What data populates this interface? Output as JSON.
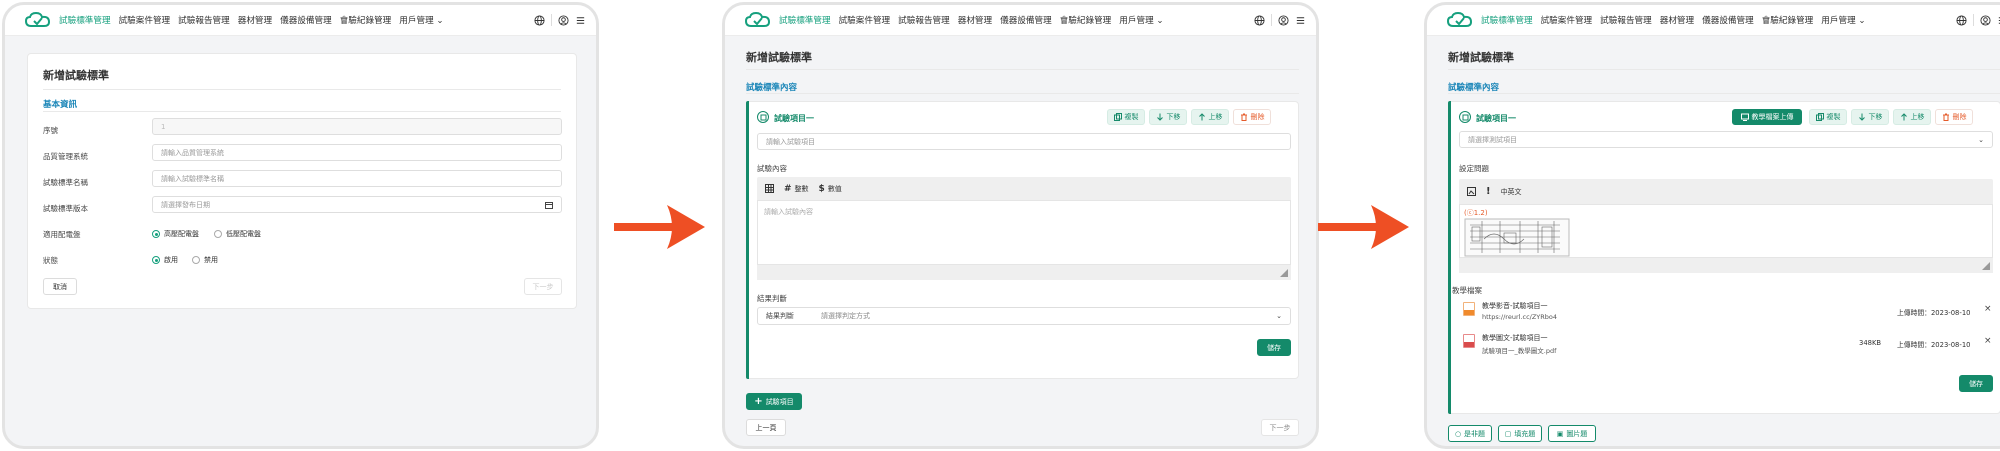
{
  "colors": {
    "accent": "#16a07e",
    "primary_btn": "#148a6a",
    "section": "#1b86b8",
    "danger": "#e55b2a",
    "arrow": "#ee4f24"
  },
  "nav": {
    "items": [
      "試驗標準管理",
      "試驗案件管理",
      "試驗報告管理",
      "器材管理",
      "儀器設備管理",
      "會驗紀錄管理",
      "用戶管理"
    ],
    "dropdown_caret": "⌄",
    "icons": [
      "globe-icon",
      "user-icon",
      "menu-icon"
    ]
  },
  "screen1": {
    "title": "新增試驗標準",
    "section": "基本資訊",
    "fields": [
      {
        "label": "序號",
        "value": "1"
      },
      {
        "label": "品質管理系統",
        "placeholder": "請輸入品質管理系統"
      },
      {
        "label": "試驗標準名稱",
        "placeholder": "請輸入試驗標準名稱"
      },
      {
        "label": "試驗標準版本",
        "placeholder": "請選擇發布日期"
      }
    ],
    "voltage": {
      "label": "適用配電盤",
      "options": [
        "高壓配電盤",
        "低壓配電盤"
      ],
      "selected": "高壓配電盤"
    },
    "status": {
      "label": "狀態",
      "options": [
        "啟用",
        "禁用"
      ],
      "selected": "啟用"
    },
    "cancel": "取消",
    "next": "下一步"
  },
  "screen2": {
    "title": "新增試驗標準",
    "section": "試驗標準內容",
    "item_title": "試驗項目一",
    "actions": [
      "複製",
      "下移",
      "上移",
      "刪除"
    ],
    "item_placeholder": "請輸入試驗項目",
    "content_label": "試驗內容",
    "toolbar": [
      "整數",
      "數值"
    ],
    "content_placeholder": "請輸入試驗內容",
    "result_label": "結果判斷",
    "result_field_label": "結果判斷",
    "result_placeholder": "請選擇判定方式",
    "save": "儲存",
    "add_item": "試驗項目",
    "prev": "上一頁",
    "next": "下一步"
  },
  "screen3": {
    "title": "新增試驗標準",
    "section": "試驗標準內容",
    "item_title": "試驗項目一",
    "upload": "教學檔案上傳",
    "actions": [
      "複製",
      "下移",
      "上移",
      "刪除"
    ],
    "item_placeholder": "請選擇測試項目",
    "question_label": "設定問題",
    "toolbar_text": "中英文",
    "image_caption": "(ⓒ1.2)",
    "files_label": "教學檔案",
    "files": [
      {
        "name": "教學影音-試驗項目一",
        "sub": "https://reurl.cc/ZYRbo4",
        "size": "",
        "uploaded": "上傳時間：2023-08-10"
      },
      {
        "name": "教學圖文-試驗項目一",
        "sub": "試驗項目一_教學圖文.pdf",
        "size": "348KB",
        "uploaded": "上傳時間：2023-08-10"
      }
    ],
    "save": "儲存",
    "bottom_buttons": [
      "是非題",
      "填充題",
      "圖片題"
    ]
  }
}
